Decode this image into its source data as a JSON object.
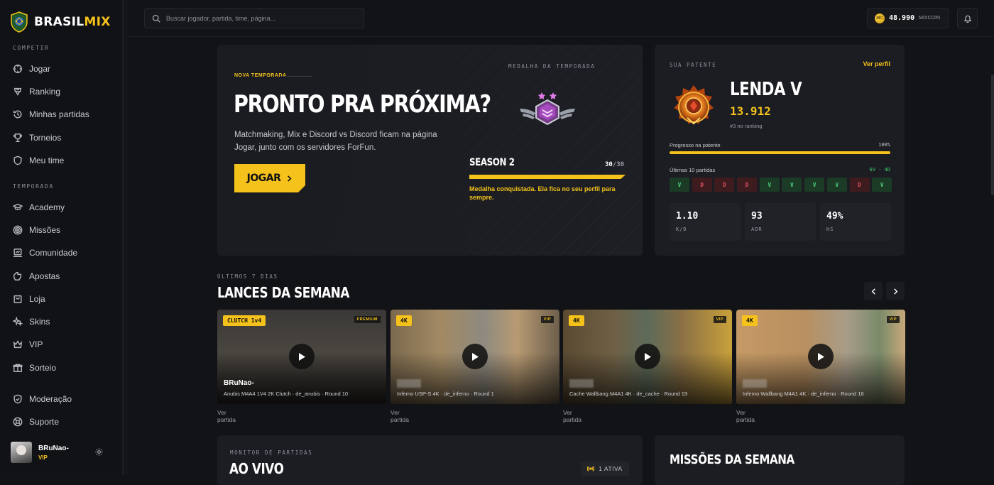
{
  "brand": {
    "name_part1": "BRASIL",
    "name_part2": "MIX"
  },
  "sidebar": {
    "sections": [
      {
        "label": "COMPETIR"
      },
      {
        "label": "TEMPORADA"
      }
    ],
    "items": [
      {
        "label": "Jogar",
        "icon": "crosshair-icon"
      },
      {
        "label": "Ranking",
        "icon": "trophy-icon"
      },
      {
        "label": "Minhas partidas",
        "icon": "history-icon"
      },
      {
        "label": "Torneios",
        "icon": "cup-icon"
      },
      {
        "label": "Meu time",
        "icon": "shield-icon"
      },
      {
        "label": "Academy",
        "icon": "graduation-cap-icon"
      },
      {
        "label": "Missões",
        "icon": "target-icon"
      },
      {
        "label": "Comunidade",
        "icon": "community-icon"
      },
      {
        "label": "Apostas",
        "icon": "bets-icon"
      },
      {
        "label": "Loja",
        "icon": "store-icon"
      },
      {
        "label": "Skins",
        "icon": "sparkle-icon"
      },
      {
        "label": "VIP",
        "icon": "crown-icon"
      },
      {
        "label": "Sorteio",
        "icon": "gift-icon"
      },
      {
        "label": "Moderação",
        "icon": "shield-check-icon"
      },
      {
        "label": "Suporte",
        "icon": "lifebuoy-icon"
      }
    ],
    "user": {
      "name": "BRuNao-",
      "tag": "VIP"
    }
  },
  "topbar": {
    "search_placeholder": "Buscar jogador, partida, time, página...",
    "coins": {
      "amount": "48.990",
      "unit": "MIXCOIN",
      "coin_glyph": "MC"
    }
  },
  "hero": {
    "kicker": "NOVA TEMPORADA",
    "title": "PRONTO PRA PRÓXIMA?",
    "description": "Matchmaking, Mix e Discord vs Discord ficam na página Jogar, junto com os servidores ForFun.",
    "button": "JOGAR",
    "medal_label": "MEDALHA DA TEMPORADA",
    "season_name": "SEASON 2",
    "season_progress": "30",
    "season_total": "/30",
    "season_progress_fraction": 1.0,
    "season_message": "Medalha conquistada. Ela fica no seu perfil para sempre."
  },
  "rank": {
    "label": "SUA PATENTE",
    "link": "Ver perfil",
    "tier": "LENDA V",
    "points": "13.912",
    "position": "#3 no ranking",
    "progress_label": "Progresso na patente",
    "progress_value": "100%",
    "progress_fraction": 1.0,
    "last_label": "Últimas 10 partidas",
    "last_summary": "6V · 4D",
    "results": [
      "V",
      "D",
      "D",
      "D",
      "V",
      "V",
      "V",
      "V",
      "D",
      "V"
    ],
    "stats": [
      {
        "value": "1.10",
        "label": "K/D"
      },
      {
        "value": "93",
        "label": "ADR"
      },
      {
        "value": "49%",
        "label": "HS"
      }
    ]
  },
  "highlights": {
    "kicker": "ÚLTIMOS 7 DIAS",
    "title": "LANCES DA SEMANA",
    "clips": [
      {
        "badge": "CLUTCH 1v4",
        "tier": "PREMIUM",
        "player": "BRuNao-",
        "meta": "Anubis M4A4 1V4 2K Clutch · de_anubis · Round 10",
        "link": "Ver partida"
      },
      {
        "badge": "4K",
        "tier": "VIP",
        "player": "",
        "meta": "Inferno USP-S 4K · de_inferno · Round 1",
        "link": "Ver partida"
      },
      {
        "badge": "4K",
        "tier": "VIP",
        "player": "",
        "meta": "Cache Wallbang M4A1 4K · de_cache · Round 19",
        "link": "Ver partida"
      },
      {
        "badge": "4K",
        "tier": "VIP",
        "player": "",
        "meta": "Inferno Wallbang M4A1 4K · de_inferno · Round 16",
        "link": "Ver partida"
      }
    ]
  },
  "live": {
    "label": "MONITOR DE PARTIDAS",
    "title": "AO VIVO",
    "active": "1 ATIVA"
  },
  "missions": {
    "title": "MISSÕES DA SEMANA"
  },
  "colors": {
    "accent": "#f4c21a",
    "win": "#4fd37a",
    "loss": "#e25561",
    "bg": "#121317",
    "card": "#1b1d22"
  }
}
